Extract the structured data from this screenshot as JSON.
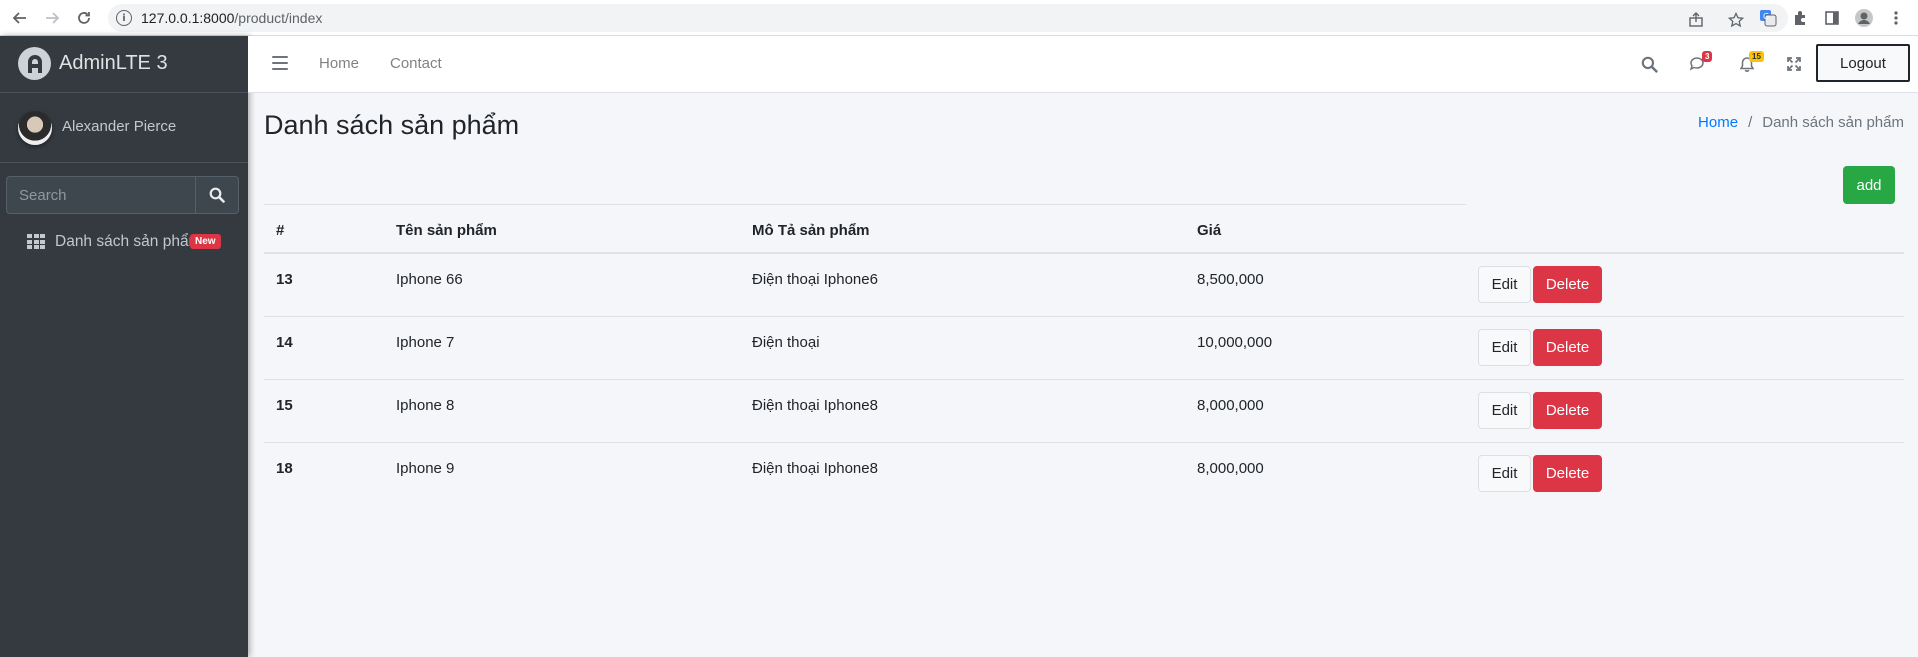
{
  "browser": {
    "url_host": "127.0.0.1:8000",
    "url_path": "/product/index"
  },
  "sidebar": {
    "brand": "AdminLTE 3",
    "user_name": "Alexander Pierce",
    "search_placeholder": "Search",
    "nav_items": [
      {
        "label": "Danh sách sản phẩm",
        "badge": "New",
        "icon": "th-grid-icon"
      }
    ]
  },
  "topnav": {
    "links": [
      "Home",
      "Contact"
    ],
    "messages_count": "3",
    "notifications_count": "15",
    "logout_label": "Logout",
    "colors": {
      "messages_badge": "#dc3545",
      "notifications_badge": "#ffc107"
    }
  },
  "page": {
    "title": "Danh sách sản phẩm",
    "breadcrumb": {
      "home": "Home",
      "separator": "/",
      "current": "Danh sách sản phẩm"
    },
    "add_label": "add"
  },
  "table": {
    "headers": [
      "#",
      "Tên sản phẩm",
      "Mô Tả sản phẩm",
      "Giá"
    ],
    "rows": [
      {
        "id": "13",
        "name": "Iphone 66",
        "description": "Điện thoại Iphone6",
        "price": "8,500,000"
      },
      {
        "id": "14",
        "name": "Iphone 7",
        "description": "Điện thoại",
        "price": "10,000,000"
      },
      {
        "id": "15",
        "name": "Iphone 8",
        "description": "Điện thoại Iphone8",
        "price": "8,000,000"
      },
      {
        "id": "18",
        "name": "Iphone 9",
        "description": "Điện thoại Iphone8",
        "price": "8,000,000"
      }
    ],
    "edit_label": "Edit",
    "delete_label": "Delete"
  }
}
